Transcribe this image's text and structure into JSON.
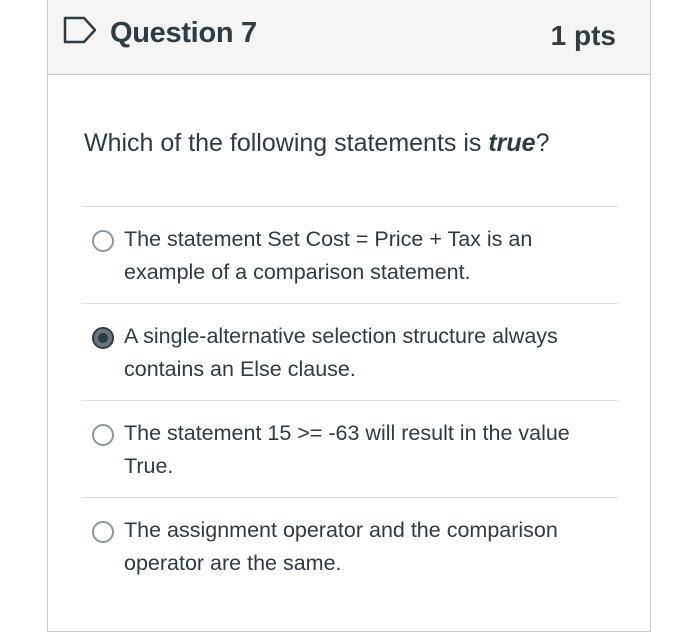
{
  "question": {
    "title": "Question 7",
    "points": "1 pts",
    "prompt_before": "Which of the following statements is ",
    "prompt_emphasis": "true",
    "prompt_after": "?"
  },
  "answers": [
    {
      "text": "The statement Set Cost = Price + Tax is an example of a comparison statement.",
      "selected": false
    },
    {
      "text": "A single-alternative selection structure always contains an Else clause.",
      "selected": true
    },
    {
      "text": "The statement 15 >= -63 will result in the value True.",
      "selected": false
    },
    {
      "text": "The assignment operator and the comparison operator are the same.",
      "selected": false
    }
  ],
  "colors": {
    "text": "#2d3b45",
    "header_bg": "#f5f5f5",
    "border": "#c7cdd1",
    "flag": "#2d3b45"
  },
  "icons": {
    "flag": "bookmark-flag-icon"
  }
}
